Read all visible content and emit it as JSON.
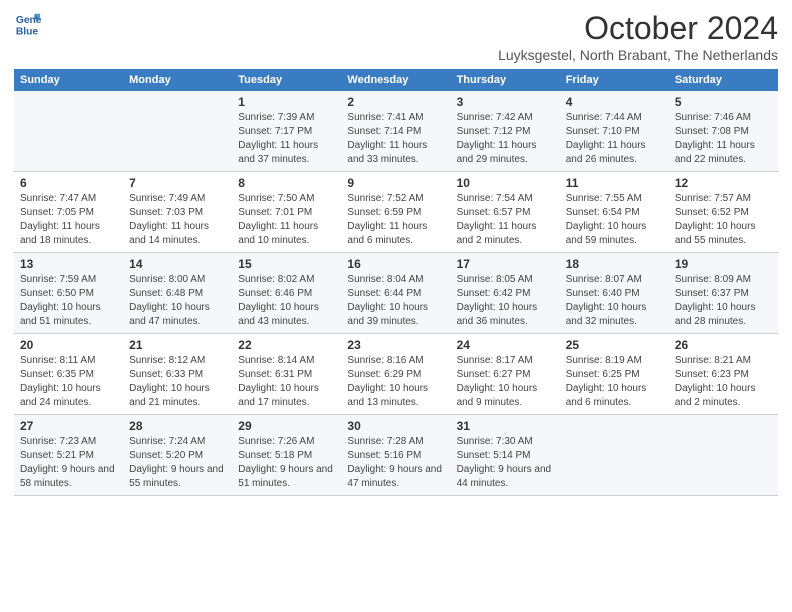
{
  "header": {
    "logo_line1": "General",
    "logo_line2": "Blue",
    "title": "October 2024",
    "subtitle": "Luyksgestel, North Brabant, The Netherlands"
  },
  "weekdays": [
    "Sunday",
    "Monday",
    "Tuesday",
    "Wednesday",
    "Thursday",
    "Friday",
    "Saturday"
  ],
  "weeks": [
    [
      {
        "day": "",
        "info": ""
      },
      {
        "day": "",
        "info": ""
      },
      {
        "day": "1",
        "info": "Sunrise: 7:39 AM\nSunset: 7:17 PM\nDaylight: 11 hours and 37 minutes."
      },
      {
        "day": "2",
        "info": "Sunrise: 7:41 AM\nSunset: 7:14 PM\nDaylight: 11 hours and 33 minutes."
      },
      {
        "day": "3",
        "info": "Sunrise: 7:42 AM\nSunset: 7:12 PM\nDaylight: 11 hours and 29 minutes."
      },
      {
        "day": "4",
        "info": "Sunrise: 7:44 AM\nSunset: 7:10 PM\nDaylight: 11 hours and 26 minutes."
      },
      {
        "day": "5",
        "info": "Sunrise: 7:46 AM\nSunset: 7:08 PM\nDaylight: 11 hours and 22 minutes."
      }
    ],
    [
      {
        "day": "6",
        "info": "Sunrise: 7:47 AM\nSunset: 7:05 PM\nDaylight: 11 hours and 18 minutes."
      },
      {
        "day": "7",
        "info": "Sunrise: 7:49 AM\nSunset: 7:03 PM\nDaylight: 11 hours and 14 minutes."
      },
      {
        "day": "8",
        "info": "Sunrise: 7:50 AM\nSunset: 7:01 PM\nDaylight: 11 hours and 10 minutes."
      },
      {
        "day": "9",
        "info": "Sunrise: 7:52 AM\nSunset: 6:59 PM\nDaylight: 11 hours and 6 minutes."
      },
      {
        "day": "10",
        "info": "Sunrise: 7:54 AM\nSunset: 6:57 PM\nDaylight: 11 hours and 2 minutes."
      },
      {
        "day": "11",
        "info": "Sunrise: 7:55 AM\nSunset: 6:54 PM\nDaylight: 10 hours and 59 minutes."
      },
      {
        "day": "12",
        "info": "Sunrise: 7:57 AM\nSunset: 6:52 PM\nDaylight: 10 hours and 55 minutes."
      }
    ],
    [
      {
        "day": "13",
        "info": "Sunrise: 7:59 AM\nSunset: 6:50 PM\nDaylight: 10 hours and 51 minutes."
      },
      {
        "day": "14",
        "info": "Sunrise: 8:00 AM\nSunset: 6:48 PM\nDaylight: 10 hours and 47 minutes."
      },
      {
        "day": "15",
        "info": "Sunrise: 8:02 AM\nSunset: 6:46 PM\nDaylight: 10 hours and 43 minutes."
      },
      {
        "day": "16",
        "info": "Sunrise: 8:04 AM\nSunset: 6:44 PM\nDaylight: 10 hours and 39 minutes."
      },
      {
        "day": "17",
        "info": "Sunrise: 8:05 AM\nSunset: 6:42 PM\nDaylight: 10 hours and 36 minutes."
      },
      {
        "day": "18",
        "info": "Sunrise: 8:07 AM\nSunset: 6:40 PM\nDaylight: 10 hours and 32 minutes."
      },
      {
        "day": "19",
        "info": "Sunrise: 8:09 AM\nSunset: 6:37 PM\nDaylight: 10 hours and 28 minutes."
      }
    ],
    [
      {
        "day": "20",
        "info": "Sunrise: 8:11 AM\nSunset: 6:35 PM\nDaylight: 10 hours and 24 minutes."
      },
      {
        "day": "21",
        "info": "Sunrise: 8:12 AM\nSunset: 6:33 PM\nDaylight: 10 hours and 21 minutes."
      },
      {
        "day": "22",
        "info": "Sunrise: 8:14 AM\nSunset: 6:31 PM\nDaylight: 10 hours and 17 minutes."
      },
      {
        "day": "23",
        "info": "Sunrise: 8:16 AM\nSunset: 6:29 PM\nDaylight: 10 hours and 13 minutes."
      },
      {
        "day": "24",
        "info": "Sunrise: 8:17 AM\nSunset: 6:27 PM\nDaylight: 10 hours and 9 minutes."
      },
      {
        "day": "25",
        "info": "Sunrise: 8:19 AM\nSunset: 6:25 PM\nDaylight: 10 hours and 6 minutes."
      },
      {
        "day": "26",
        "info": "Sunrise: 8:21 AM\nSunset: 6:23 PM\nDaylight: 10 hours and 2 minutes."
      }
    ],
    [
      {
        "day": "27",
        "info": "Sunrise: 7:23 AM\nSunset: 5:21 PM\nDaylight: 9 hours and 58 minutes."
      },
      {
        "day": "28",
        "info": "Sunrise: 7:24 AM\nSunset: 5:20 PM\nDaylight: 9 hours and 55 minutes."
      },
      {
        "day": "29",
        "info": "Sunrise: 7:26 AM\nSunset: 5:18 PM\nDaylight: 9 hours and 51 minutes."
      },
      {
        "day": "30",
        "info": "Sunrise: 7:28 AM\nSunset: 5:16 PM\nDaylight: 9 hours and 47 minutes."
      },
      {
        "day": "31",
        "info": "Sunrise: 7:30 AM\nSunset: 5:14 PM\nDaylight: 9 hours and 44 minutes."
      },
      {
        "day": "",
        "info": ""
      },
      {
        "day": "",
        "info": ""
      }
    ]
  ]
}
